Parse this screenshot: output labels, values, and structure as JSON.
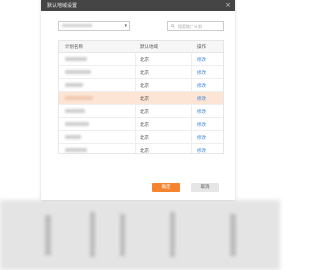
{
  "dialog": {
    "title": "默认地域设置",
    "close_icon": "×",
    "select_caret": "▾",
    "search_placeholder": "搜索推广计划"
  },
  "table": {
    "headers": [
      "计划名称",
      "默认地域",
      "操作"
    ],
    "rows": [
      {
        "region": "北京",
        "action": "修改",
        "highlighted": false
      },
      {
        "region": "北京",
        "action": "修改",
        "highlighted": false
      },
      {
        "region": "北京",
        "action": "修改",
        "highlighted": false
      },
      {
        "region": "北京",
        "action": "修改",
        "highlighted": true
      },
      {
        "region": "北京",
        "action": "修改",
        "highlighted": false
      },
      {
        "region": "北京",
        "action": "修改",
        "highlighted": false
      },
      {
        "region": "北京",
        "action": "修改",
        "highlighted": false
      },
      {
        "region": "北京",
        "action": "修改",
        "highlighted": false
      }
    ]
  },
  "buttons": {
    "ok": "确定",
    "cancel": "取消"
  },
  "icons": {
    "close": "close-icon",
    "search": "search-icon",
    "caret": "chevron-down-icon"
  },
  "colors": {
    "titlebar": "#454545",
    "highlight_row": "#fde5d6",
    "link": "#3a86d8",
    "primary_button": "#f4852e"
  }
}
